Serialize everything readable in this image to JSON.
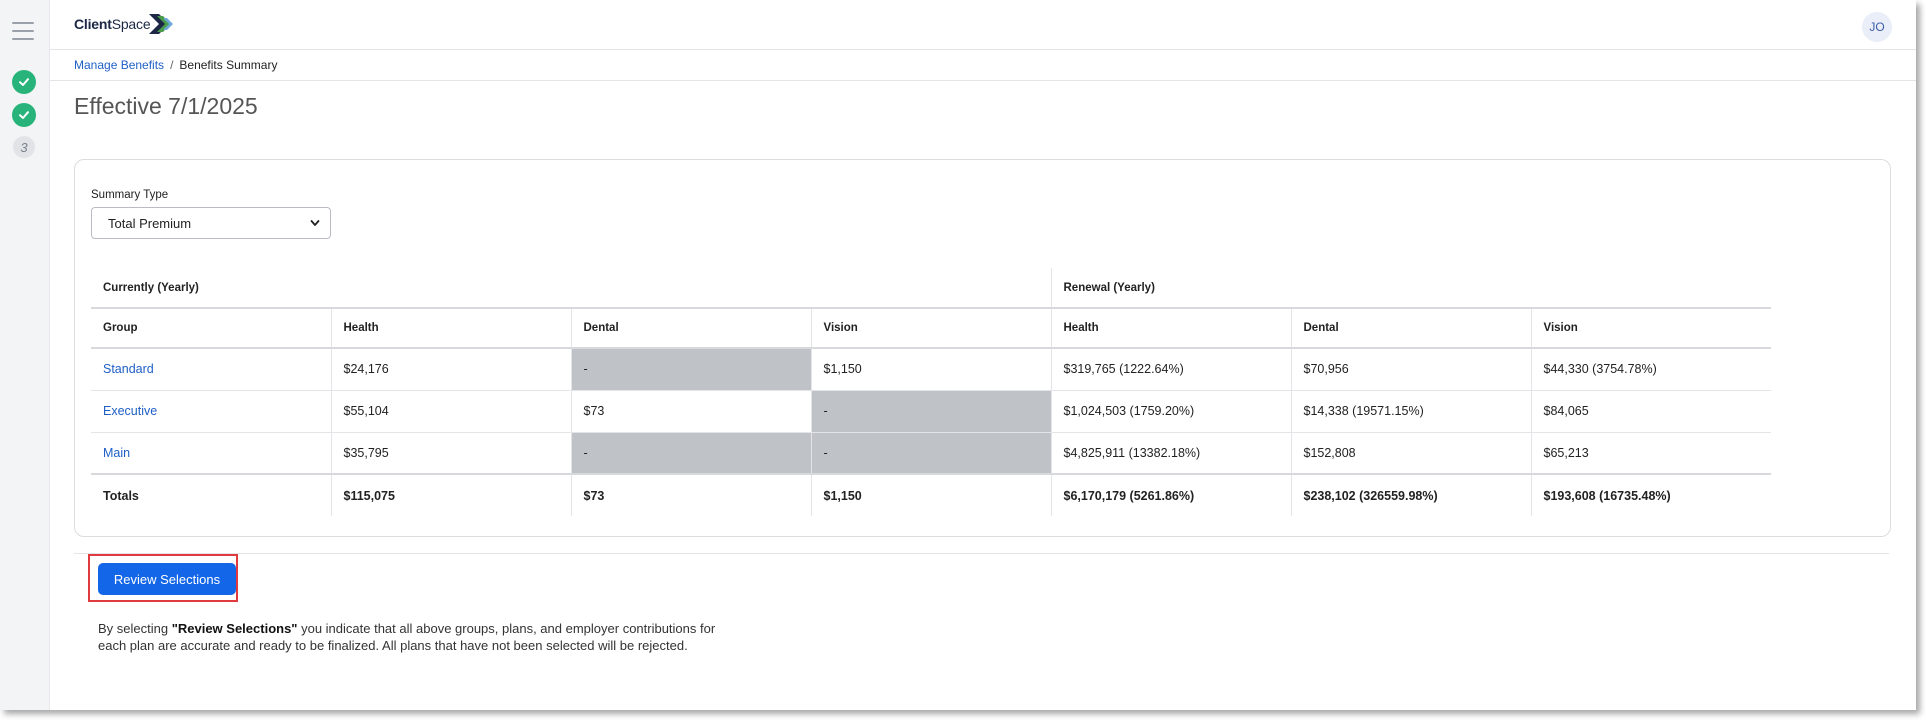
{
  "app": {
    "logo_text_bold": "Client",
    "logo_text_rest": "Space",
    "user_initials": "JO"
  },
  "steps": [
    {
      "state": "complete"
    },
    {
      "state": "complete"
    },
    {
      "state": "current",
      "number": "3"
    }
  ],
  "breadcrumb": {
    "parent": "Manage Benefits",
    "separator": "/",
    "current": "Benefits Summary"
  },
  "page": {
    "title": "Effective 7/1/2025"
  },
  "summary": {
    "type_label": "Summary Type",
    "type_value": "Total Premium",
    "group_currently": "Currently (Yearly)",
    "group_renewal": "Renewal (Yearly)",
    "columns": [
      "Group",
      "Health",
      "Dental",
      "Vision",
      "Health",
      "Dental",
      "Vision"
    ],
    "rows": [
      {
        "group": "Standard",
        "cur_health": "$24,176",
        "cur_dental": "-",
        "cur_vision": "$1,150",
        "ren_health": "$319,765 (1222.64%)",
        "ren_dental": "$70,956",
        "ren_vision": "$44,330 (3754.78%)"
      },
      {
        "group": "Executive",
        "cur_health": "$55,104",
        "cur_dental": "$73",
        "cur_vision": "-",
        "ren_health": "$1,024,503 (1759.20%)",
        "ren_dental": "$14,338 (19571.15%)",
        "ren_vision": "$84,065"
      },
      {
        "group": "Main",
        "cur_health": "$35,795",
        "cur_dental": "-",
        "cur_vision": "-",
        "ren_health": "$4,825,911 (13382.18%)",
        "ren_dental": "$152,808",
        "ren_vision": "$65,213"
      }
    ],
    "totals": {
      "label": "Totals",
      "cur_health": "$115,075",
      "cur_dental": "$73",
      "cur_vision": "$1,150",
      "ren_health": "$6,170,179 (5261.86%)",
      "ren_dental": "$238,102 (326559.98%)",
      "ren_vision": "$193,608 (16735.48%)"
    }
  },
  "actions": {
    "review_button": "Review Selections",
    "disclaimer_prefix": "By selecting ",
    "disclaimer_bold": "\"Review Selections\"",
    "disclaimer_suffix": " you indicate that all above groups, plans, and employer contributions for each plan are accurate and ready to be finalized. All plans that have not been selected will be rejected."
  },
  "colors": {
    "accent": "#1466e8",
    "link": "#1f5fc5",
    "success": "#27b37a",
    "highlight": "#e0393e",
    "na_cell": "#bfc2c6"
  }
}
